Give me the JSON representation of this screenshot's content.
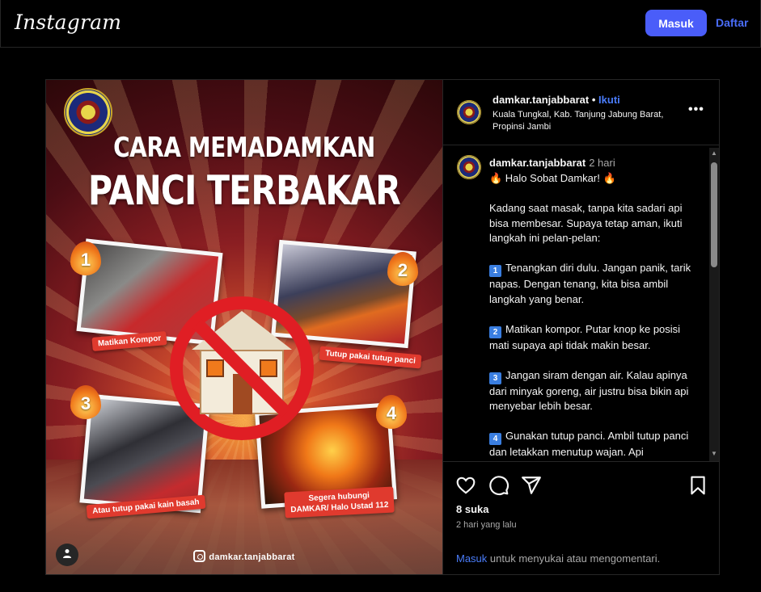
{
  "topbar": {
    "logo": "Instagram",
    "login_label": "Masuk",
    "signup_label": "Daftar"
  },
  "poster": {
    "headline_line1": "CARA MEMADAMKAN",
    "headline_line2": "PANCI TERBAKAR",
    "steps": [
      {
        "number": "1",
        "caption": "Matikan Kompor"
      },
      {
        "number": "2",
        "caption": "Tutup pakai tutup panci"
      },
      {
        "number": "3",
        "caption": "Atau tutup pakai kain basah"
      },
      {
        "number": "4",
        "caption_line1": "Segera hubungi",
        "caption_line2": "DAMKAR/ Halo Ustad 112"
      }
    ],
    "handle": "damkar.tanjabbarat"
  },
  "post_header": {
    "username": "damkar.tanjabbarat",
    "separator": "•",
    "follow_label": "Ikuti",
    "location": "Kuala Tungkal, Kab. Tanjung Jabung Barat, Propinsi Jambi",
    "more_icon": "more-horizontal-icon"
  },
  "caption": {
    "username": "damkar.tanjabbarat",
    "time": "2 hari",
    "greeting": "🔥 Halo Sobat Damkar! 🔥",
    "intro": "Kadang saat masak, tanpa kita sadari api bisa membesar. Supaya tetap aman, ikuti langkah ini pelan-pelan:",
    "steps": [
      {
        "badge": "1",
        "text": "Tenangkan diri dulu. Jangan panik, tarik napas. Dengan tenang, kita bisa ambil langkah yang benar."
      },
      {
        "badge": "2",
        "text": "Matikan kompor. Putar knop ke posisi mati supaya api tidak makin besar."
      },
      {
        "badge": "3",
        "text": "Jangan siram dengan air. Kalau apinya dari minyak goreng, air justru bisa bikin api menyebar lebih besar."
      },
      {
        "badge": "4",
        "text": "Gunakan tutup panci. Ambil tutup panci dan letakkan menutup wajan. Api"
      }
    ]
  },
  "actions": {
    "likes": "8 suka",
    "posted": "2 hari yang lalu",
    "login_link": "Masuk",
    "login_prompt_rest": " untuk menyukai atau mengomentari."
  },
  "colors": {
    "accent": "#4a5df9",
    "link": "#4a7cf9",
    "background": "#000000"
  }
}
